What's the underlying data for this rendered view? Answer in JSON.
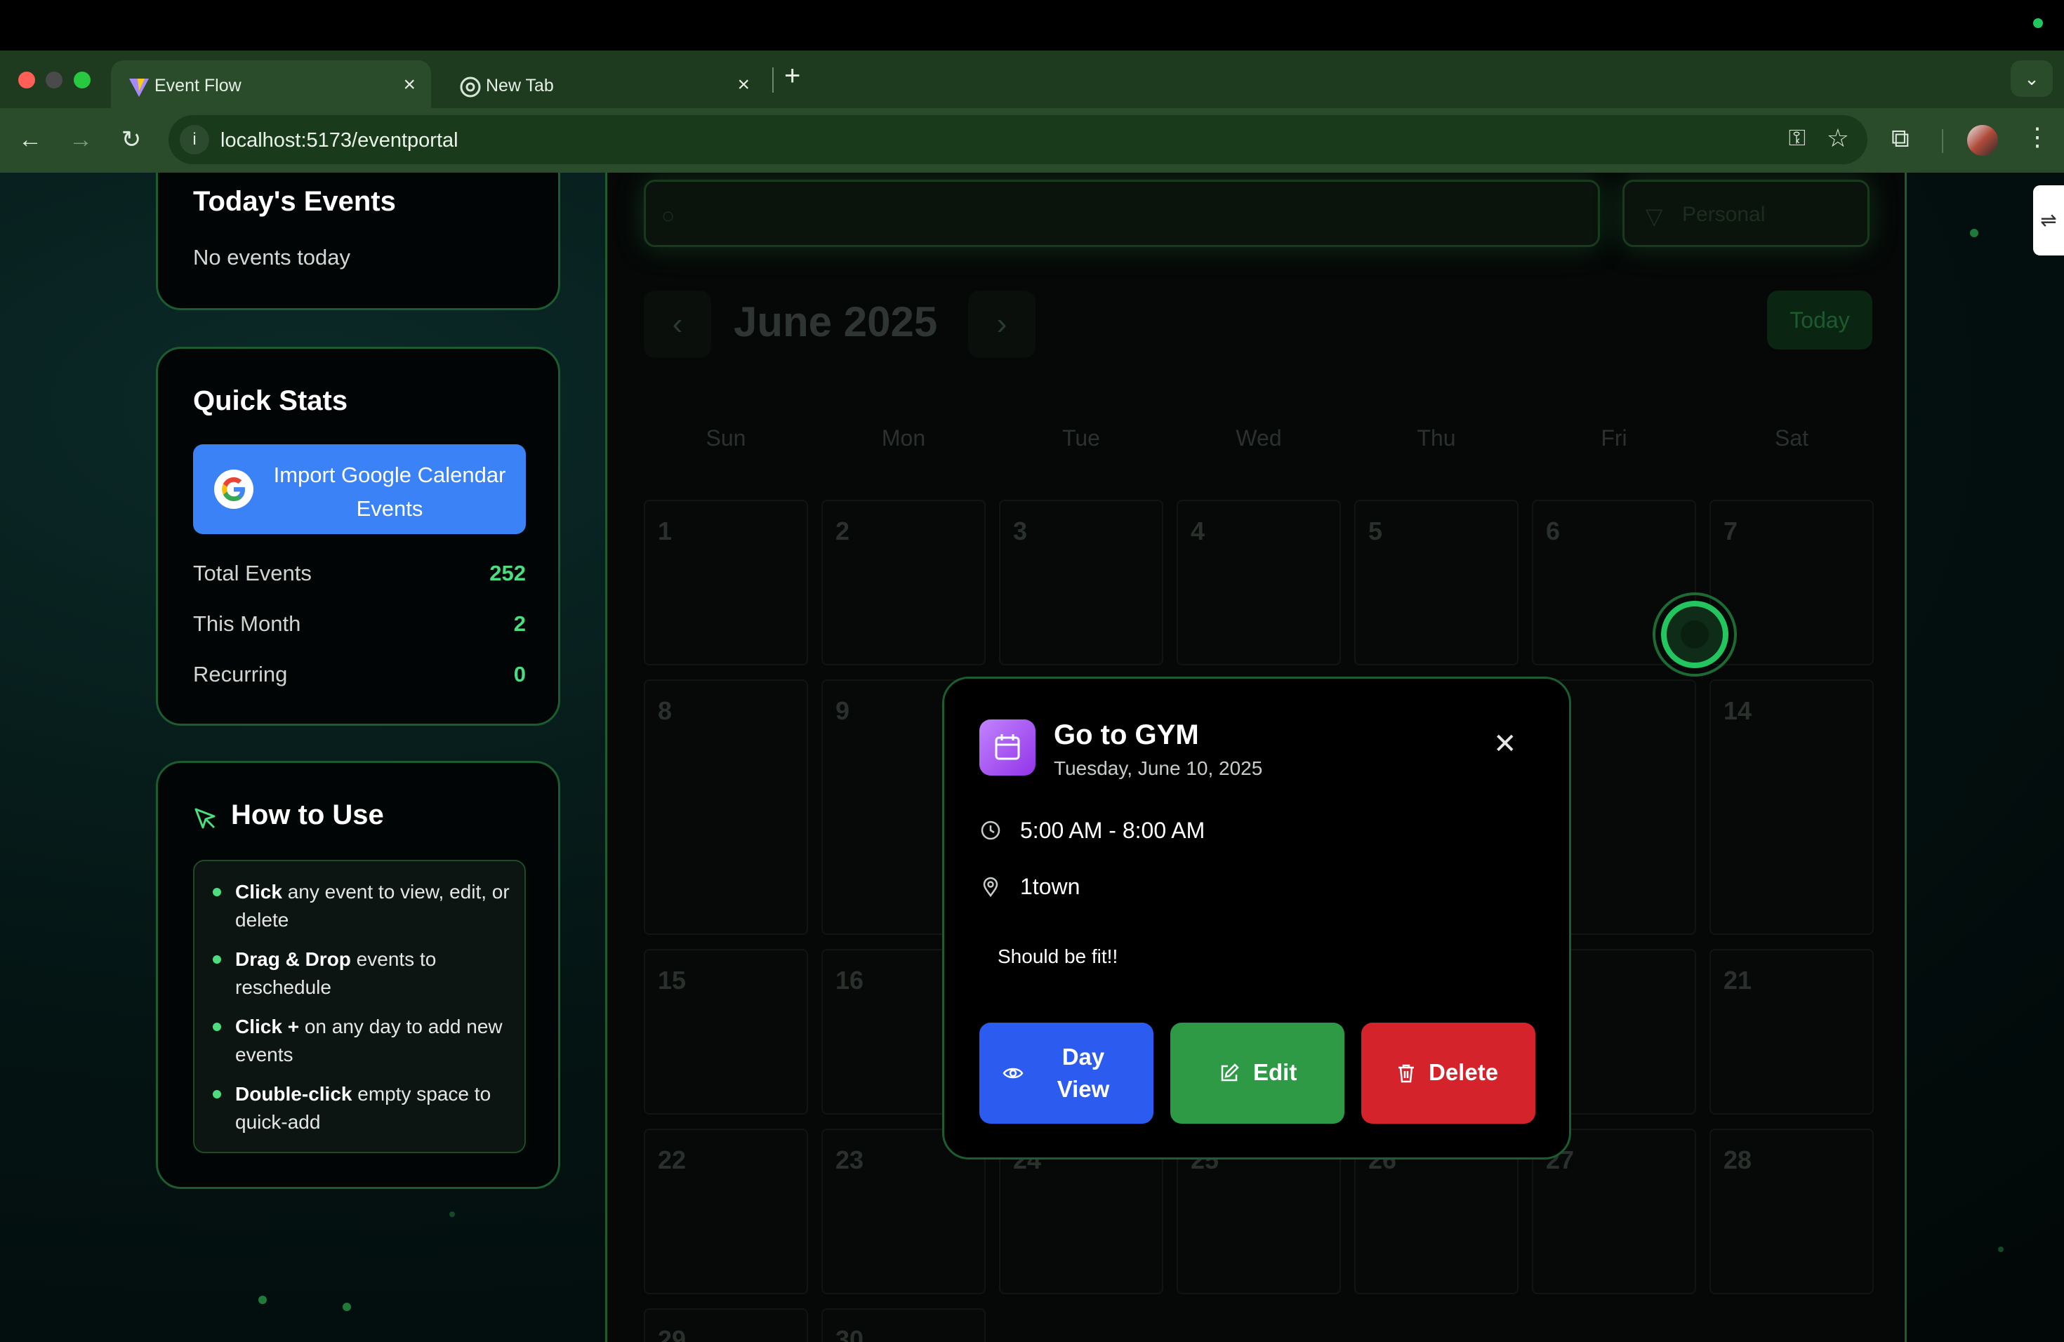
{
  "browser": {
    "tabs": [
      {
        "title": "Event Flow",
        "active": true
      },
      {
        "title": "New Tab",
        "active": false
      }
    ],
    "url": "localhost:5173/eventportal"
  },
  "sidebar": {
    "todays_events": {
      "title": "Today's Events",
      "empty_text": "No events today"
    },
    "quick_stats": {
      "title": "Quick Stats",
      "import_button": "Import Google Calendar Events",
      "stats": [
        {
          "label": "Total Events",
          "value": "252"
        },
        {
          "label": "This Month",
          "value": "2"
        },
        {
          "label": "Recurring",
          "value": "0"
        }
      ]
    },
    "how_to_use": {
      "title": "How to Use",
      "items": [
        {
          "bold": "Click",
          "text": " any event to view, edit, or delete"
        },
        {
          "bold": "Drag & Drop",
          "text": " events to reschedule"
        },
        {
          "bold": "Click +",
          "text": " on any day to add new events"
        },
        {
          "bold": "Double-click",
          "text": " empty space to quick-add"
        }
      ]
    }
  },
  "calendar": {
    "filter_label": "Personal",
    "month_title": "June 2025",
    "today_button": "Today",
    "weekdays": [
      "Sun",
      "Mon",
      "Tue",
      "Wed",
      "Thu",
      "Fri",
      "Sat"
    ],
    "visible_days": [
      "1",
      "2",
      "3",
      "4",
      "5",
      "6",
      "7",
      "8",
      "9",
      "14",
      "15",
      "16",
      "21",
      "22",
      "23",
      "24",
      "25",
      "26",
      "27",
      "28",
      "29",
      "30"
    ]
  },
  "event_modal": {
    "title": "Go to GYM",
    "date": "Tuesday, June 10, 2025",
    "time": "5:00 AM - 8:00 AM",
    "location": "1town",
    "description": "Should be fit!!",
    "buttons": {
      "day_view": "Day View",
      "edit": "Edit",
      "delete": "Delete"
    }
  },
  "colors": {
    "accent_green": "#4ade80",
    "card_border": "#1c5c2e",
    "google_button": "#3b82f6",
    "day_view_button": "#2c5bf0",
    "edit_button": "#2e9a45",
    "delete_button": "#d4232b"
  }
}
